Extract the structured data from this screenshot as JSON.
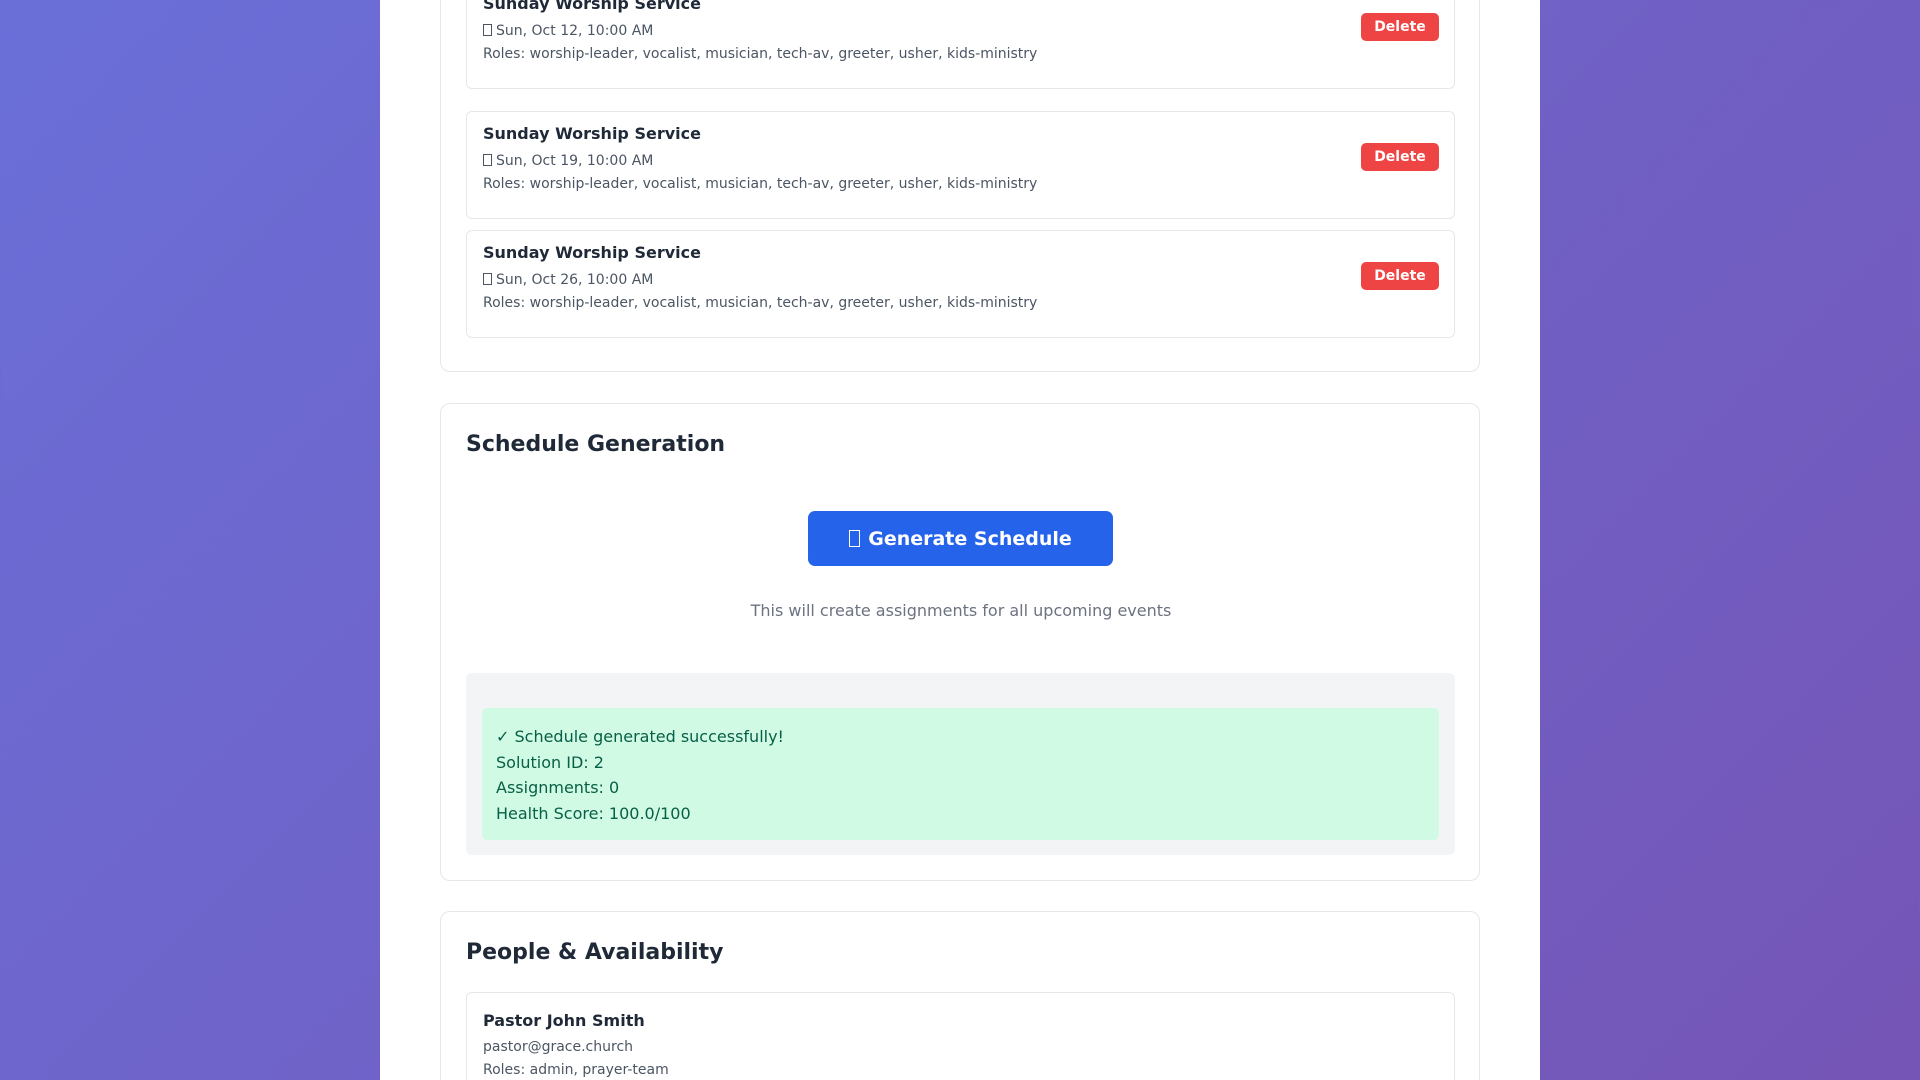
{
  "events": [
    {
      "title": "Sunday Worship Service",
      "date": "Sun, Oct 12, 10:00 AM",
      "roles": "Roles: worship-leader, vocalist, musician, tech-av, greeter, usher, kids-ministry",
      "delete_label": "Delete"
    },
    {
      "title": "Sunday Worship Service",
      "date": "Sun, Oct 19, 10:00 AM",
      "roles": "Roles: worship-leader, vocalist, musician, tech-av, greeter, usher, kids-ministry",
      "delete_label": "Delete"
    },
    {
      "title": "Sunday Worship Service",
      "date": "Sun, Oct 26, 10:00 AM",
      "roles": "Roles: worship-leader, vocalist, musician, tech-av, greeter, usher, kids-ministry",
      "delete_label": "Delete"
    }
  ],
  "schedule": {
    "title": "Schedule Generation",
    "button_label": "Generate Schedule",
    "button_icon": "calendar-icon",
    "hint": "This will create assignments for all upcoming events",
    "result": {
      "status": "✓ Schedule generated successfully!",
      "solution_id": "Solution ID: 2",
      "assignments": "Assignments: 0",
      "health_score": "Health Score: 100.0/100"
    }
  },
  "people": {
    "title": "People & Availability",
    "items": [
      {
        "name": "Pastor John Smith",
        "email": "pastor@grace.church",
        "roles": "Roles: admin, prayer-team"
      }
    ]
  },
  "colors": {
    "background_gradient_start": "#6a6fd8",
    "background_gradient_end": "#7555b6",
    "primary": "#2563eb",
    "danger": "#ef4444",
    "success_bg": "#d1fae5",
    "success_text": "#065f46"
  }
}
